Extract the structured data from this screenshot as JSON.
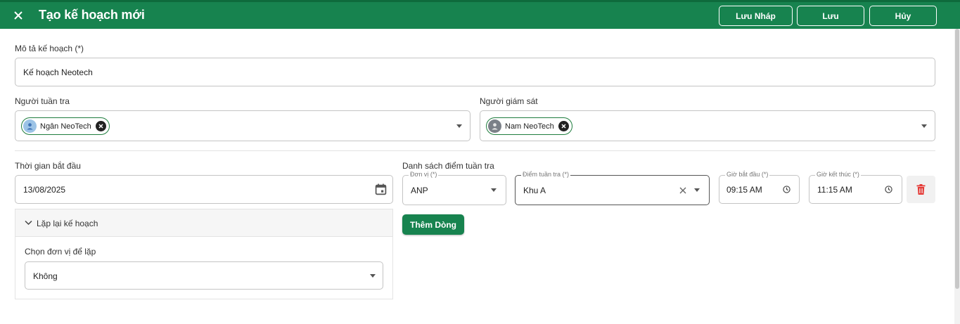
{
  "header": {
    "title": "Tạo kế hoạch mới",
    "draft_label": "Lưu Nháp",
    "save_label": "Lưu",
    "cancel_label": "Hủy"
  },
  "description": {
    "label": "Mô tả kế hoạch (*)",
    "value": "Kế hoạch Neotech"
  },
  "patroller": {
    "label": "Người tuần tra",
    "chip": "Ngân NeoTech"
  },
  "supervisor": {
    "label": "Người giám sát",
    "chip": "Nam NeoTech"
  },
  "start_time": {
    "label": "Thời gian bắt đầu",
    "value": "13/08/2025"
  },
  "repeat": {
    "header": "Lặp lại kế hoạch",
    "unit_label": "Chọn đơn vị để lặp",
    "unit_value": "Không"
  },
  "checkpoints": {
    "title": "Danh sách điểm tuần tra",
    "unit_label": "Đơn vị (*)",
    "unit_value": "ANP",
    "point_label": "Điểm tuần tra (*)",
    "point_value": "Khu A",
    "start_label": "Giờ bắt đầu (*)",
    "start_value": "09:15 AM",
    "end_label": "Giờ kết thúc (*)",
    "end_value": "11:15 AM",
    "add_row_label": "Thêm Dòng"
  },
  "colors": {
    "primary": "#17834f",
    "danger": "#e53935"
  },
  "icons": [
    "close-icon",
    "person-icon",
    "chip-close-icon",
    "calendar-icon",
    "chevron-down-icon",
    "clear-icon",
    "clock-icon",
    "trash-icon"
  ]
}
